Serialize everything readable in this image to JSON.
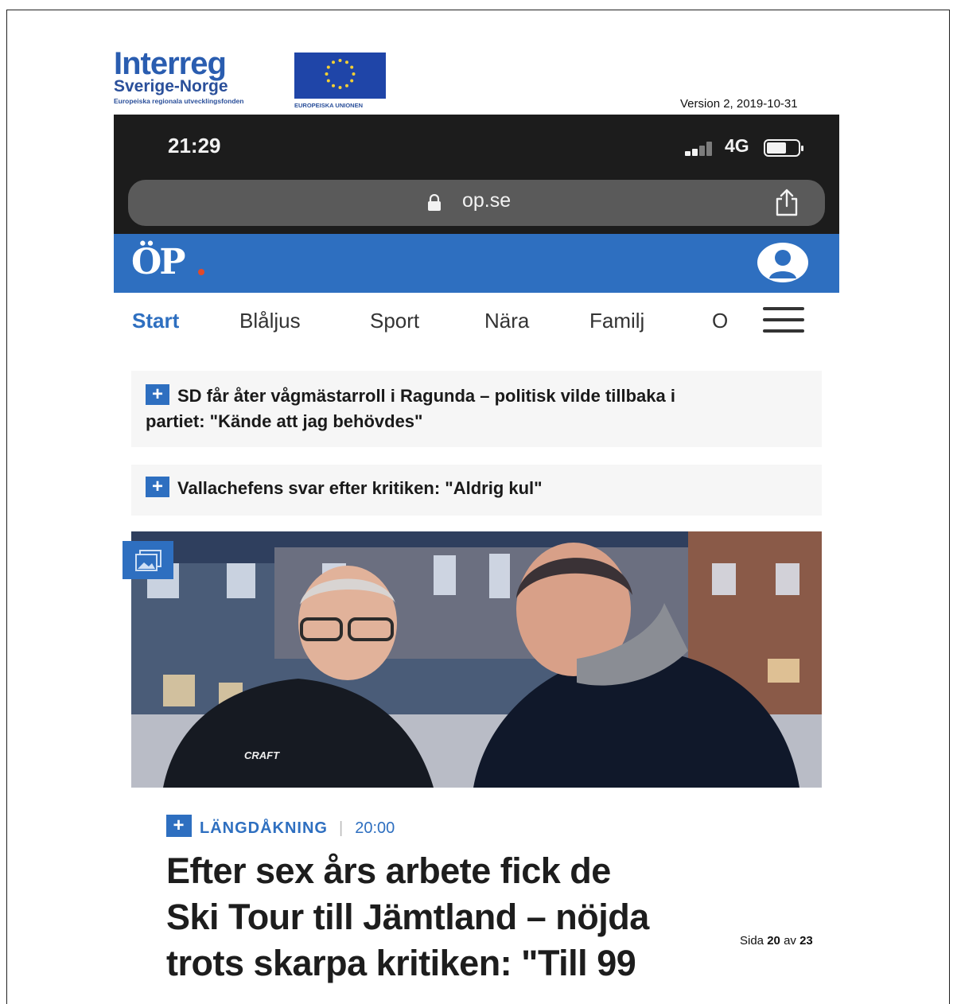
{
  "document": {
    "interreg_brand": "Interreg",
    "interreg_region": "Sverige-Norge",
    "interreg_fund": "Europeiska regionala utvecklingsfonden",
    "eu_label": "EUROPEISKA UNIONEN",
    "version": "Version 2, 2019-10-31",
    "page_label": "Sida",
    "page_current": "20",
    "page_of": "av",
    "page_total": "23"
  },
  "status_bar": {
    "time": "21:29",
    "network": "4G"
  },
  "browser": {
    "url": "op.se"
  },
  "site": {
    "logo": "ÖP",
    "nav": [
      "Start",
      "Blåljus",
      "Sport",
      "Nära",
      "Familj",
      "O"
    ]
  },
  "teasers": [
    {
      "badge": "+",
      "line1": "SD får åter vågmästarroll i Ragunda – politisk vilde tillbaka i",
      "line2": "partiet: \"Kände att jag behövdes\""
    },
    {
      "badge": "+",
      "line1": "Vallachefens svar efter kritiken: \"Aldrig kul\""
    }
  ],
  "article": {
    "photo_text": "CRAFT",
    "badge": "+",
    "category": "LÄNGDÅKNING",
    "time": "20:00",
    "headline_l1": "Efter sex års arbete fick de",
    "headline_l2": "Ski Tour till Jämtland – nöjda",
    "headline_l3": "trots skarpa kritiken: \"Till 99"
  },
  "colors": {
    "brand_blue": "#2e6fc0",
    "phone_dark": "#1c1c1c"
  }
}
